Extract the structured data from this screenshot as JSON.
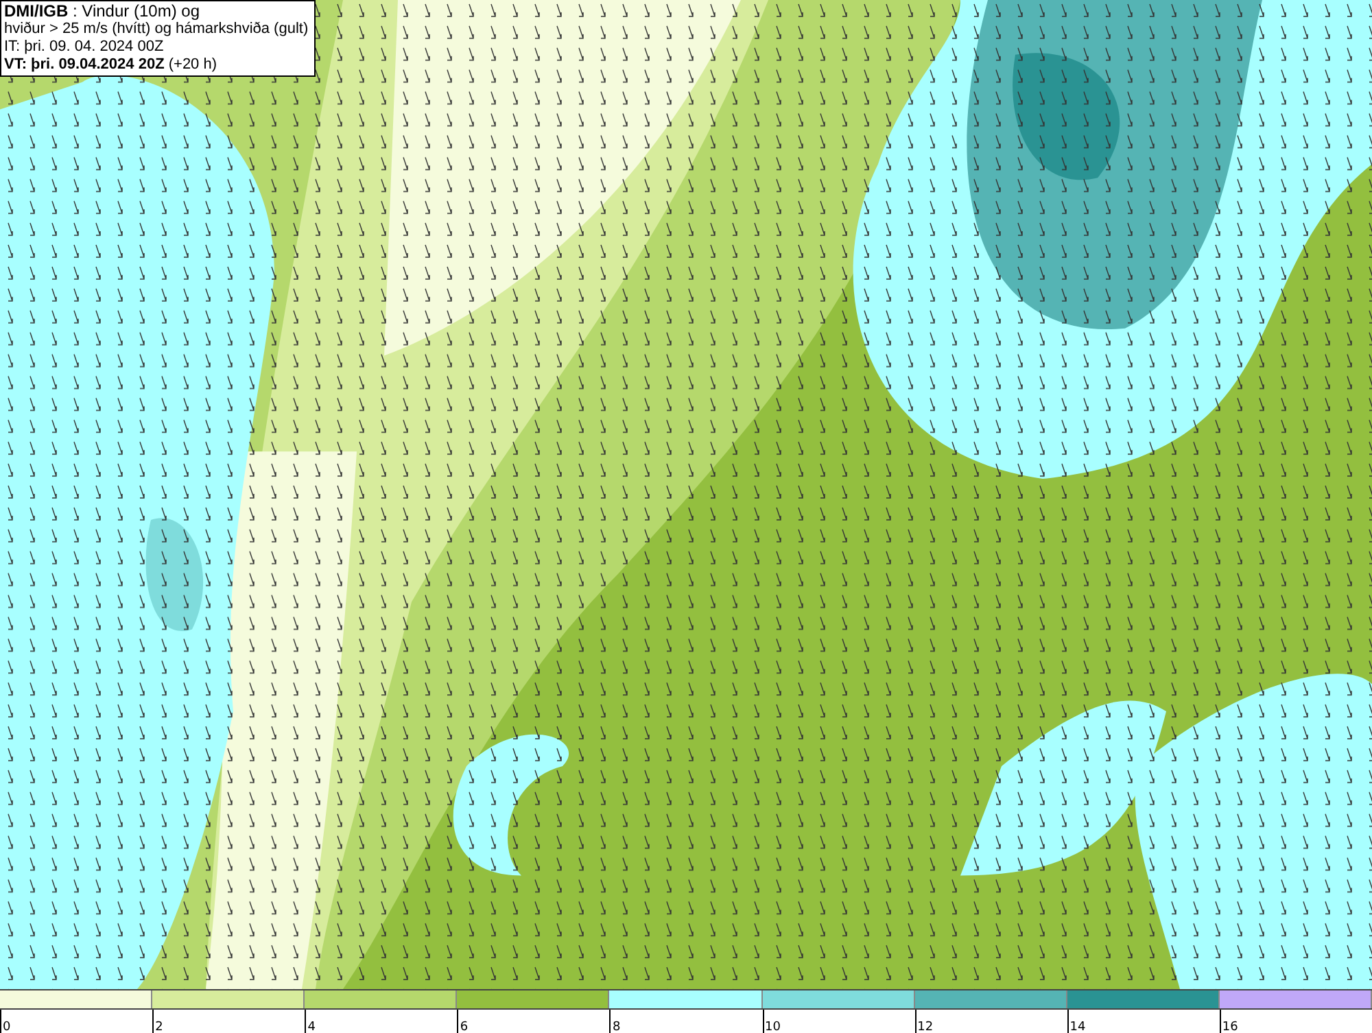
{
  "header": {
    "lines": [
      "**DMI/IGB** : Vindur (10m) og",
      "hviður > 25 m/s (hvítt) og hámarkshviða (gult)",
      "IT: þri. 09. 04. 2024 00Z",
      "**VT: þri. 09.04.2024 20Z** (+20 h)"
    ]
  },
  "legend": {
    "segments": [
      {
        "color": "#f5fbdc"
      },
      {
        "color": "#d7ec9c"
      },
      {
        "color": "#b5d86c"
      },
      {
        "color": "#93bf3f"
      },
      {
        "color": "#a8ffff"
      },
      {
        "color": "#7fdcdc"
      },
      {
        "color": "#55b4b4"
      },
      {
        "color": "#2a9393"
      },
      {
        "color": "#c0a8f8"
      }
    ],
    "labels": [
      "0",
      "2",
      "4",
      "6",
      "8",
      "10",
      "12",
      "14",
      "16"
    ]
  }
}
